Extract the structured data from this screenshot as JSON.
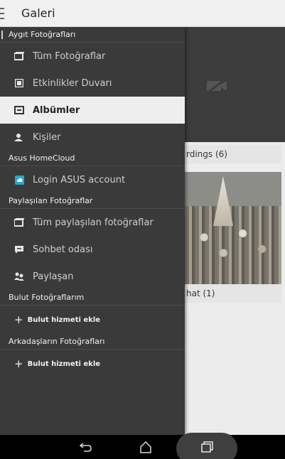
{
  "app_bar": {
    "title": "Galeri"
  },
  "content": {
    "album_label_1": "rdings (6)",
    "album_label_2": "hat (1)"
  },
  "drawer": {
    "sections": [
      {
        "title": "Aygıt Fotoğrafları"
      },
      {
        "title": "Asus HomeCloud"
      },
      {
        "title": "Paylaşılan Fotoğraflar"
      },
      {
        "title": "Bulut Fotoğraflarım"
      },
      {
        "title": "Arkadaşların Fotoğrafları"
      }
    ],
    "items": {
      "all_photos": "Tüm Fotoğraflar",
      "events_wall": "Etkinlikler Duvarı",
      "albums": "Albümler",
      "people": "Kişiler",
      "login_asus": "Login ASUS account",
      "all_shared": "Tüm paylaşılan fotoğraflar",
      "chat_room": "Sohbet odası",
      "sharer": "Paylaşan"
    },
    "add_cloud_1": "Bulut hizmeti ekle",
    "add_cloud_2": "Bulut hizmeti ekle",
    "active_item": "albums",
    "accent_color": "#2aa6d8"
  },
  "icons": {
    "menu": "hamburger-icon",
    "back": "back-icon",
    "home": "home-icon",
    "recents": "recents-icon"
  }
}
